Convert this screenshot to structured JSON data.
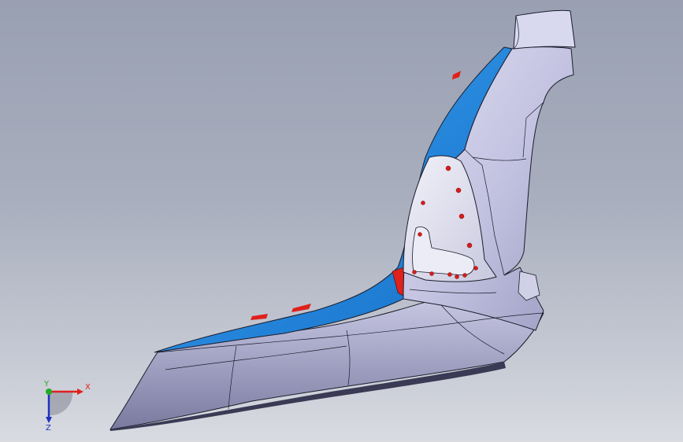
{
  "viewport": {
    "background_top": "#99a0b2",
    "background_bottom": "#d9dbe1"
  },
  "model": {
    "shell_color": "#c9c9e6",
    "shell_shadow_color": "#8f8fb3",
    "blue_surface_color": "#1e88e0",
    "red_edge_color": "#e0201a",
    "marker_color": "#d81c1c",
    "edge_color": "#1c1c2c",
    "marker_icon": "red-dot-icon"
  },
  "triad": {
    "x_label": "X",
    "y_label": "Y",
    "z_label": "Z",
    "x_color": "#e02020",
    "y_color": "#22aa22",
    "z_color": "#2030c0"
  }
}
